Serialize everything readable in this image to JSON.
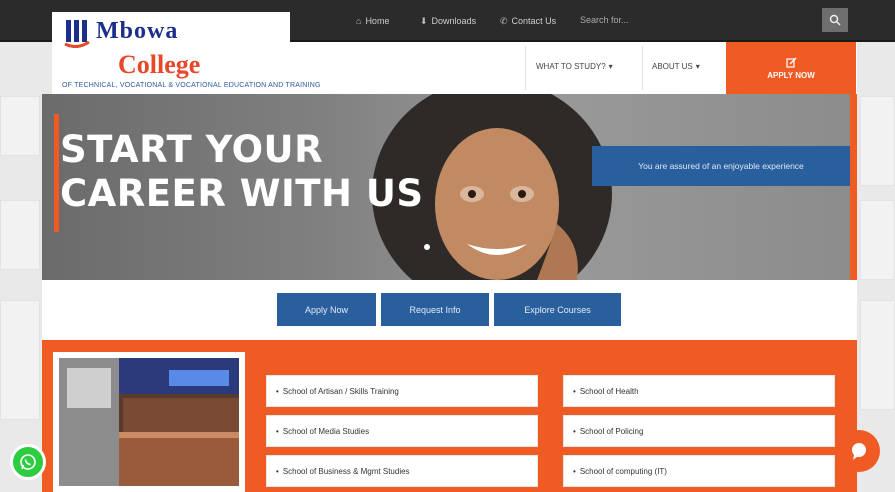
{
  "topbar": {
    "links": [
      {
        "icon": "home-icon",
        "label": "Home"
      },
      {
        "icon": "download-icon",
        "label": "Downloads"
      },
      {
        "icon": "phone-icon",
        "label": "Contact Us"
      }
    ],
    "search_placeholder": "Search for..."
  },
  "logo": {
    "name_line1": "Mbowa",
    "name_line2": "College",
    "tagline": "OF TECHNICAL, VOCATIONAL & VOCATIONAL EDUCATION AND TRAINING"
  },
  "nav": {
    "items": [
      "WHAT TO STUDY?",
      "ABOUT US"
    ],
    "apply_label": "APPLY NOW"
  },
  "hero": {
    "title_line1": "START YOUR",
    "title_line2": "CAREER WITH US",
    "badge": "You are assured of an enjoyable experience"
  },
  "cta": {
    "buttons": [
      "Apply Now",
      "Request Info",
      "Explore Courses"
    ]
  },
  "schools": {
    "items": [
      "School of Artisan / Skills Training",
      "School of Health",
      "School of Media Studies",
      "School of Policing",
      "School of Business & Mgmt Studies",
      "School of computing (IT)"
    ]
  },
  "colors": {
    "accent": "#f05a23",
    "primary_blue": "#2a5f9e",
    "topbar": "#2b2b2b",
    "whatsapp": "#2ecc40"
  }
}
